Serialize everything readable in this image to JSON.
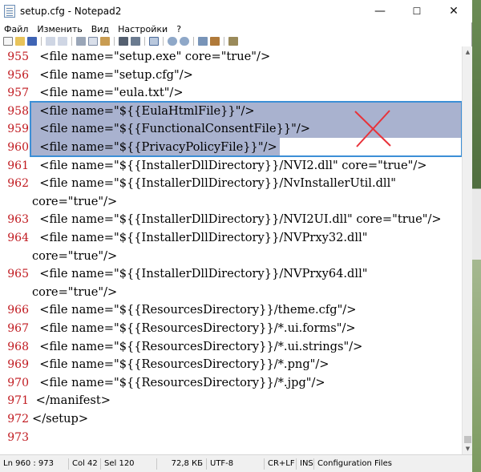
{
  "window": {
    "title": "setup.cfg - Notepad2",
    "controls": [
      "—",
      "☐",
      "✕"
    ]
  },
  "menu": [
    "Файл",
    "Изменить",
    "Вид",
    "Настройки",
    "?"
  ],
  "colors": {
    "line_numbers": "#c0191f",
    "selection": "#a9b2cf",
    "selection_border": "#3c8fd6",
    "cross_mark": "#e8323a"
  },
  "lines": [
    {
      "num": "955",
      "text": "  <file name=\"setup.exe\" core=\"true\"/>"
    },
    {
      "num": "956",
      "text": "  <file name=\"setup.cfg\"/>"
    },
    {
      "num": "957",
      "text": "  <file name=\"eula.txt\"/>"
    },
    {
      "num": "958",
      "text": "  <file name=\"${{EulaHtmlFile}}\"/>"
    },
    {
      "num": "959",
      "text": "  <file name=\"${{FunctionalConsentFile}}\"/>"
    },
    {
      "num": "960",
      "text": "  <file name=\"${{PrivacyPolicyFile}}\"/>"
    },
    {
      "num": "961",
      "text": "  <file name=\"${{InstallerDllDirectory}}/NVI2.dll\" core=\"true\"/>"
    },
    {
      "num": "962",
      "text": "  <file name=\"${{InstallerDllDirectory}}/NvInstallerUtil.dll\""
    },
    {
      "num": "",
      "text": "core=\"true\"/>"
    },
    {
      "num": "963",
      "text": "  <file name=\"${{InstallerDllDirectory}}/NVI2UI.dll\" core=\"true\"/>"
    },
    {
      "num": "964",
      "text": "  <file name=\"${{InstallerDllDirectory}}/NVPrxy32.dll\""
    },
    {
      "num": "",
      "text": "core=\"true\"/>"
    },
    {
      "num": "965",
      "text": "  <file name=\"${{InstallerDllDirectory}}/NVPrxy64.dll\""
    },
    {
      "num": "",
      "text": "core=\"true\"/>"
    },
    {
      "num": "966",
      "text": "  <file name=\"${{ResourcesDirectory}}/theme.cfg\"/>"
    },
    {
      "num": "967",
      "text": "  <file name=\"${{ResourcesDirectory}}/*.ui.forms\"/>"
    },
    {
      "num": "968",
      "text": "  <file name=\"${{ResourcesDirectory}}/*.ui.strings\"/>"
    },
    {
      "num": "969",
      "text": "  <file name=\"${{ResourcesDirectory}}/*.png\"/>"
    },
    {
      "num": "970",
      "text": "  <file name=\"${{ResourcesDirectory}}/*.jpg\"/>"
    },
    {
      "num": "971",
      "text": " </manifest>"
    },
    {
      "num": "972",
      "text": "</setup>"
    },
    {
      "num": "973",
      "text": ""
    }
  ],
  "status": {
    "position": "Ln 960 : 973",
    "col": "Col 42",
    "sel": "Sel 120",
    "size": "72,8 КБ",
    "encoding": "UTF-8",
    "eol": "CR+LF",
    "ins": "INS",
    "scheme": "Configuration Files"
  }
}
